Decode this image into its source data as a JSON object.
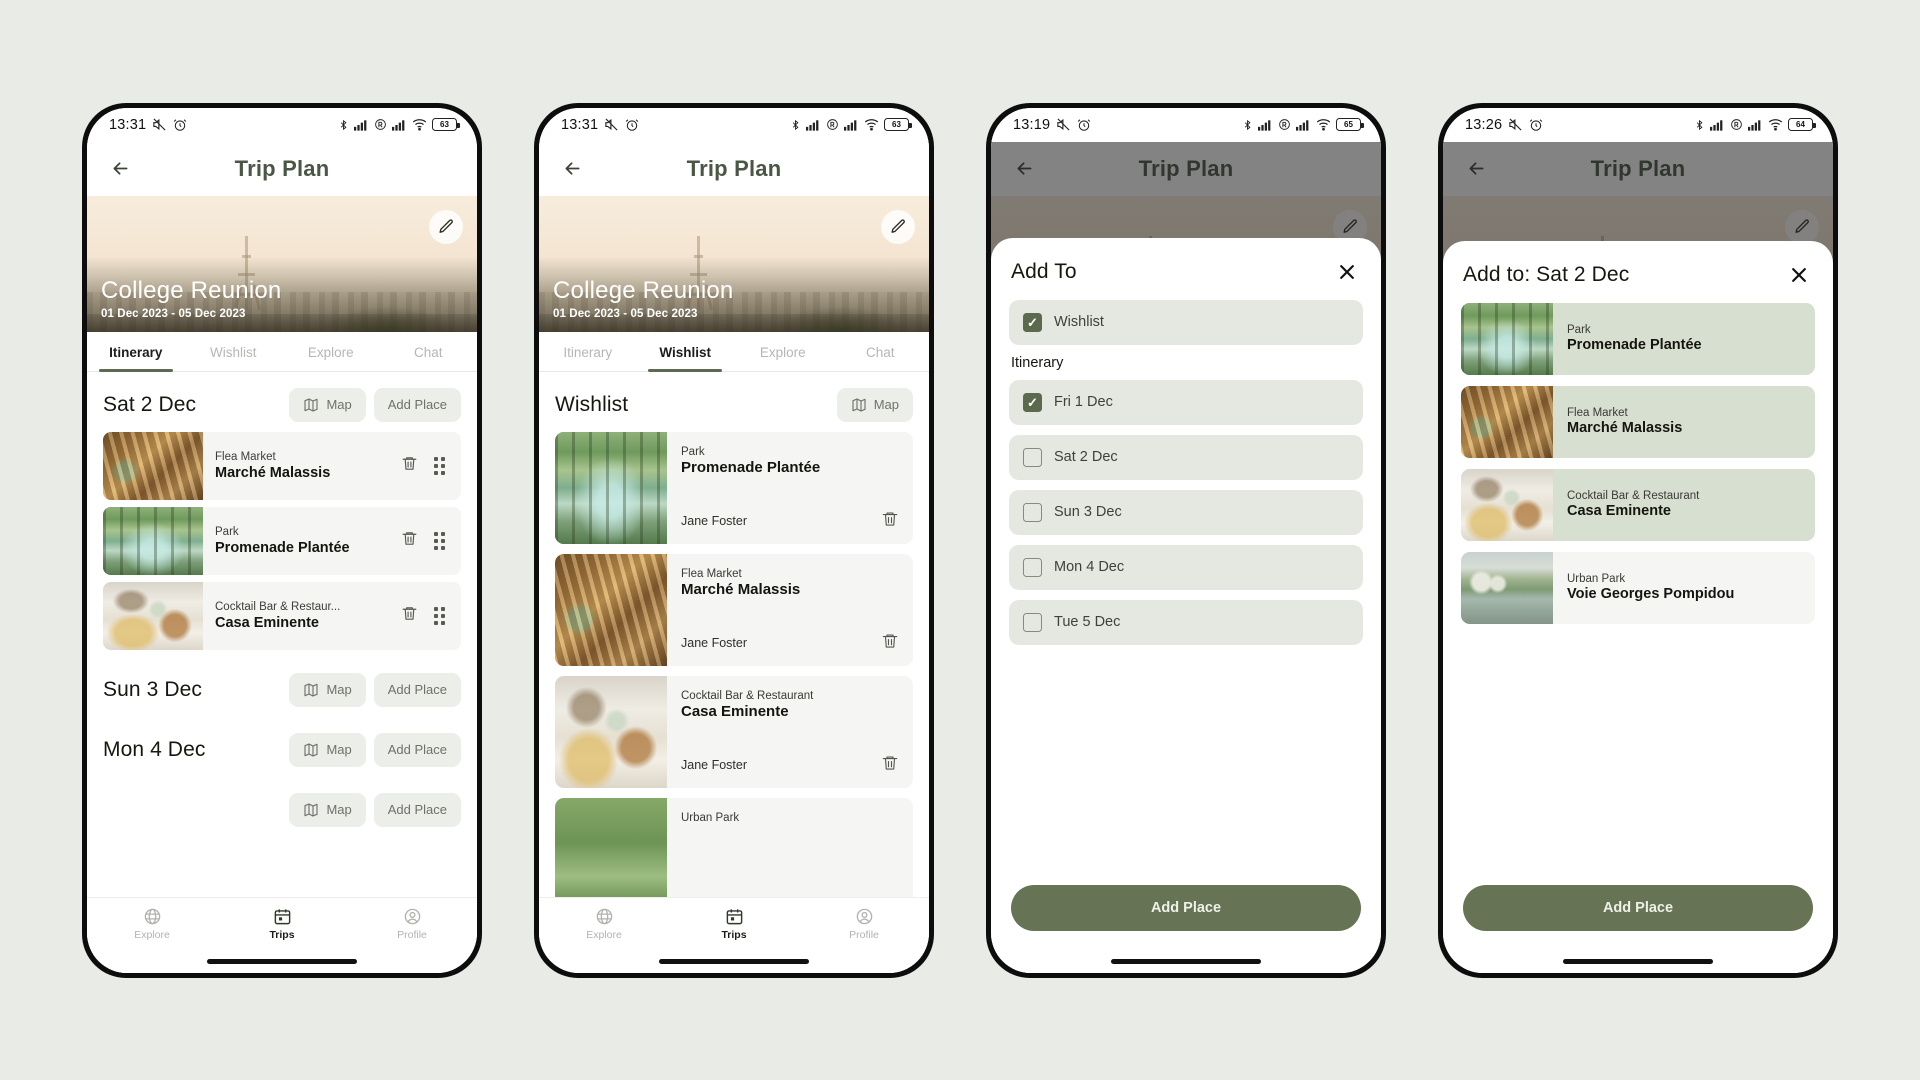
{
  "app": {
    "title": "Trip Plan",
    "trip_name": "College Reunion",
    "trip_dates": "01 Dec 2023 - 05 Dec 2023"
  },
  "tabs": [
    {
      "label": "Itinerary"
    },
    {
      "label": "Wishlist"
    },
    {
      "label": "Explore"
    },
    {
      "label": "Chat"
    }
  ],
  "bottom_nav": [
    {
      "label": "Explore",
      "icon": "globe-icon"
    },
    {
      "label": "Trips",
      "icon": "calendar-icon"
    },
    {
      "label": "Profile",
      "icon": "account-icon"
    }
  ],
  "buttons": {
    "map": "Map",
    "add_place": "Add Place",
    "add_place_primary": "Add Place"
  },
  "colors": {
    "accent": "#667355",
    "title": "#4a5745",
    "pill_bg": "#eceeea",
    "selected_card": "#d7dfd0",
    "checkbox_checked": "#5b6a4c"
  },
  "phones": [
    {
      "status": {
        "time": "13:31",
        "battery": "63",
        "icons": [
          "mute-icon",
          "alarm-icon",
          "bluetooth-icon",
          "signal-icon",
          "roaming-icon",
          "signal-icon",
          "wifi-icon",
          "battery-icon"
        ]
      },
      "active_tab": "Itinerary",
      "active_nav": "Trips",
      "days": [
        {
          "label": "Sat 2 Dec",
          "places": [
            {
              "category": "Flea Market",
              "name": "Marché Malassis",
              "thumb": "th-market"
            },
            {
              "category": "Park",
              "name": "Promenade Plantée",
              "thumb": "th-park"
            },
            {
              "category": "Cocktail Bar & Restaur...",
              "name": "Casa Eminente",
              "thumb": "th-dining"
            }
          ]
        },
        {
          "label": "Sun 3 Dec",
          "places": []
        },
        {
          "label": "Mon 4 Dec",
          "places": []
        }
      ]
    },
    {
      "status": {
        "time": "13:31",
        "battery": "63"
      },
      "active_tab": "Wishlist",
      "active_nav": "Trips",
      "section_title": "Wishlist",
      "items": [
        {
          "category": "Park",
          "name": "Promenade Plantée",
          "owner": "Jane Foster",
          "thumb": "th-park"
        },
        {
          "category": "Flea Market",
          "name": "Marché Malassis",
          "owner": "Jane Foster",
          "thumb": "th-market"
        },
        {
          "category": "Cocktail Bar & Restaurant",
          "name": "Casa Eminente",
          "owner": "Jane Foster",
          "thumb": "th-dining"
        },
        {
          "category": "Urban Park",
          "name": "",
          "owner": "",
          "thumb": "th-trees"
        }
      ]
    },
    {
      "status": {
        "time": "13:19",
        "battery": "65"
      },
      "sheet_title": "Add To",
      "group_label": "Itinerary",
      "options": [
        {
          "label": "Wishlist",
          "checked": true,
          "standalone": true
        },
        {
          "label": "Fri 1 Dec",
          "checked": true
        },
        {
          "label": "Sat 2 Dec",
          "checked": false
        },
        {
          "label": "Sun 3 Dec",
          "checked": false
        },
        {
          "label": "Mon 4 Dec",
          "checked": false
        },
        {
          "label": "Tue 5 Dec",
          "checked": false
        }
      ],
      "cta": "Add Place"
    },
    {
      "status": {
        "time": "13:26",
        "battery": "64"
      },
      "sheet_title": "Add to: Sat 2 Dec",
      "cards": [
        {
          "category": "Park",
          "name": "Promenade Plantée",
          "thumb": "th-park",
          "selected": true
        },
        {
          "category": "Flea Market",
          "name": "Marché Malassis",
          "thumb": "th-market",
          "selected": true
        },
        {
          "category": "Cocktail Bar & Restaurant",
          "name": "Casa Eminente",
          "thumb": "th-dining",
          "selected": true
        },
        {
          "category": "Urban Park",
          "name": "Voie Georges Pompidou",
          "thumb": "th-river",
          "selected": false
        }
      ],
      "cta": "Add Place"
    }
  ]
}
